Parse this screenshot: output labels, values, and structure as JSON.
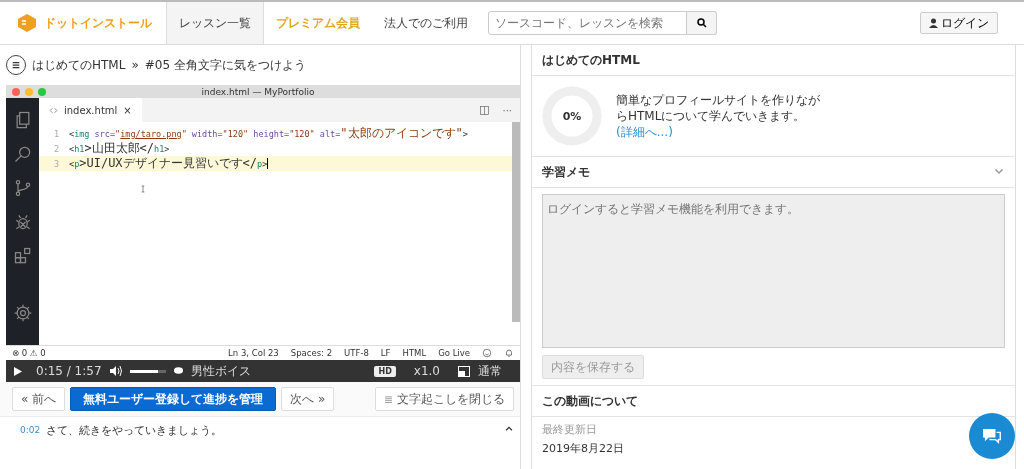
{
  "header": {
    "logo": "ドットインストール",
    "nav": [
      {
        "label": "レッスン一覧",
        "selected": true,
        "kind": "normal"
      },
      {
        "label": "プレミアム会員",
        "selected": false,
        "kind": "premium"
      },
      {
        "label": "法人でのご利用",
        "selected": false,
        "kind": "normal"
      }
    ],
    "search": {
      "placeholder": "ソースコード、レッスンを検索"
    },
    "login": "ログイン"
  },
  "breadcrumb": {
    "course": "はじめてのHTML",
    "separator": "»",
    "lesson": "#05 全角文字に気をつけよう"
  },
  "editor": {
    "title": "index.html — MyPortfolio",
    "tab": {
      "label": "index.html",
      "close": "×"
    },
    "more": "···",
    "lines": [
      {
        "number": "1",
        "current": false,
        "tokens": [
          {
            "text": "<",
            "kind": "punct"
          },
          {
            "text": "img",
            "kind": "tag"
          },
          {
            "text": " src=",
            "kind": "attr"
          },
          {
            "text": "\"",
            "kind": "str"
          },
          {
            "text": "img/taro.png",
            "kind": "link"
          },
          {
            "text": "\"",
            "kind": "str"
          },
          {
            "text": " width=",
            "kind": "attr"
          },
          {
            "text": "\"120\"",
            "kind": "str"
          },
          {
            "text": " height=",
            "kind": "attr"
          },
          {
            "text": "\"120\"",
            "kind": "str"
          },
          {
            "text": " alt=",
            "kind": "attr"
          },
          {
            "text": "\"太郎のアイコンです\"",
            "kind": "str"
          },
          {
            "text": ">",
            "kind": "punct"
          }
        ]
      },
      {
        "number": "2",
        "current": false,
        "tokens": [
          {
            "text": "<",
            "kind": "punct"
          },
          {
            "text": "h1",
            "kind": "tag"
          },
          {
            "text": ">山田太郎</",
            "kind": "punct"
          },
          {
            "text": "h1",
            "kind": "tag"
          },
          {
            "text": ">",
            "kind": "punct"
          }
        ]
      },
      {
        "number": "3",
        "current": true,
        "tokens": [
          {
            "text": "<",
            "kind": "punct"
          },
          {
            "text": "p",
            "kind": "tag"
          },
          {
            "text": ">UI/UXデザイナー見習いです</",
            "kind": "punct"
          },
          {
            "text": "p",
            "kind": "tag"
          },
          {
            "text": ">",
            "kind": "punct"
          }
        ]
      }
    ],
    "status": {
      "problems": "⊗ 0 ⚠ 0",
      "items": [
        "Ln 3, Col 23",
        "Spaces: 2",
        "UTF-8",
        "LF",
        "HTML",
        "Go Live"
      ]
    }
  },
  "player": {
    "time": "0:15 / 1:57",
    "volume": {
      "level": 0.8
    },
    "voice": "男性ボイス",
    "quality": "HD",
    "speed": "x1.0",
    "mode": "通常"
  },
  "actions": {
    "prev": "« 前へ",
    "register": "無料ユーザー登録して進捗を管理",
    "next": "次へ »",
    "transcript": "文字起こしを閉じる"
  },
  "transcript": [
    {
      "time": "0:02",
      "text": "さて、続きをやっていきましょう。"
    }
  ],
  "course_panel": {
    "title": "はじめてのHTML",
    "progress": {
      "label": "0%",
      "level": 0
    },
    "description": "簡単なプロフィールサイトを作りながらHTMLについて学んでいきます。",
    "link": "(詳細へ...)"
  },
  "memo": {
    "title": "学習メモ",
    "expanded": true,
    "placeholder": "ログインすると学習メモ機能を利用できます。",
    "save": "内容を保存する"
  },
  "about": {
    "title": "この動画について",
    "updated_label": "最終更新日",
    "updated": "2019年8月22日"
  }
}
